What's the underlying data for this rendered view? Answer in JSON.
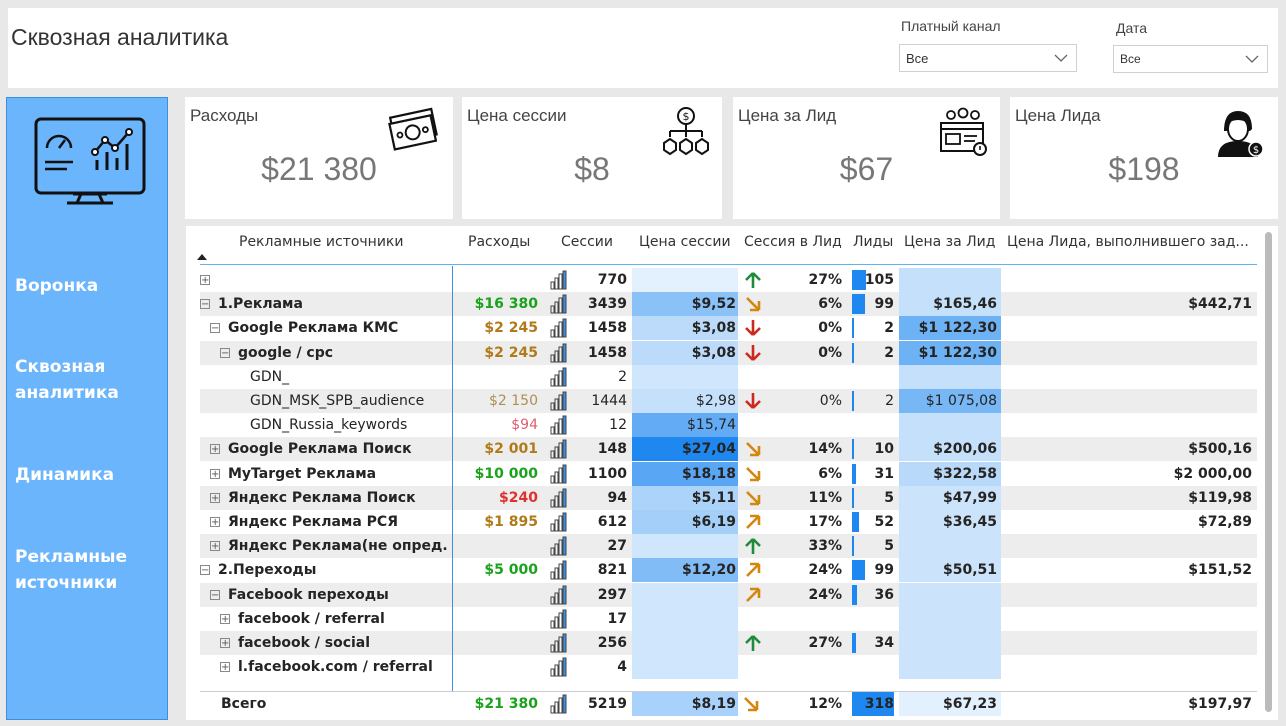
{
  "header": {
    "title": "Сквозная аналитика",
    "slicer1": {
      "label": "Платный канал",
      "value": "Все"
    },
    "slicer2": {
      "label": "Дата",
      "value": "Все"
    }
  },
  "nav": {
    "items": [
      "Воронка",
      "Сквозная аналитика",
      "Динамика",
      "Рекламные источники"
    ]
  },
  "cards": [
    {
      "label": "Расходы",
      "value": "$21 380",
      "icon": "money-icon"
    },
    {
      "label": "Цена сессии",
      "value": "$8",
      "icon": "coins-network-icon"
    },
    {
      "label": "Цена за Лид",
      "value": "$67",
      "icon": "web-form-icon"
    },
    {
      "label": "Цена Лида",
      "value": "$198",
      "icon": "person-dollar-icon"
    }
  ],
  "table": {
    "columns": [
      "Рекламные источники",
      "Расходы",
      "Сессии",
      "Цена сессии",
      "Сессия в Лид",
      "Лиды",
      "Цена за Лид",
      "Цена Лида, выполнившего зад..."
    ],
    "colors": {
      "green": "#1aa31a",
      "orange": "#b07a18",
      "red": "#e03030",
      "pink": "#e05d6e",
      "tan": "#b08f50",
      "arrow_up": "#1e8c3a",
      "arrow_diag": "#d4870f",
      "arrow_down": "#cc2a1e"
    },
    "rows": [
      {
        "level": 0,
        "exp": "+",
        "name": "",
        "bold": true,
        "cost": "",
        "cost_color": "",
        "sessions": "770",
        "cps": "",
        "cps_intensity": 0,
        "arrow": "up",
        "conv": "27%",
        "leads": "105",
        "leads_frac": 0.33,
        "cpl": "",
        "cpl_intensity": 0.15,
        "cpl2": ""
      },
      {
        "level": 0,
        "exp": "−",
        "name": "1.Реклама",
        "bold": true,
        "cost": "$16 380",
        "cost_color": "green",
        "sessions": "3439",
        "cps": "$9,52",
        "cps_intensity": 0.45,
        "arrow": "diag-down",
        "conv": "6%",
        "leads": "99",
        "leads_frac": 0.31,
        "cpl": "$165,46",
        "cpl_intensity": 0.15,
        "cpl2": "$442,71"
      },
      {
        "level": 1,
        "exp": "−",
        "name": "Google Реклама КМС",
        "bold": true,
        "cost": "$2 245",
        "cost_color": "orange",
        "sessions": "1458",
        "cps": "$3,08",
        "cps_intensity": 0.2,
        "arrow": "down",
        "conv": "0%",
        "leads": "2",
        "leads_frac": 0.006,
        "cpl": "$1 122,30",
        "cpl_intensity": 0.6,
        "cpl2": ""
      },
      {
        "level": 2,
        "exp": "−",
        "name": "google / cpc",
        "bold": true,
        "cost": "$2 245",
        "cost_color": "orange",
        "sessions": "1458",
        "cps": "$3,08",
        "cps_intensity": 0.2,
        "arrow": "down",
        "conv": "0%",
        "leads": "2",
        "leads_frac": 0.006,
        "cpl": "$1 122,30",
        "cpl_intensity": 0.6,
        "cpl2": ""
      },
      {
        "level": 3,
        "exp": "",
        "name": "GDN_",
        "bold": false,
        "cost": "",
        "cost_color": "",
        "sessions": "2",
        "cps": "",
        "cps_intensity": 0.1,
        "arrow": "",
        "conv": "",
        "leads": "",
        "leads_frac": 0,
        "cpl": "",
        "cpl_intensity": 0.15,
        "cpl2": ""
      },
      {
        "level": 3,
        "exp": "",
        "name": "GDN_MSK_SPB_audience",
        "bold": false,
        "cost": "$2 150",
        "cost_color": "tan",
        "sessions": "1444",
        "cps": "$2,98",
        "cps_intensity": 0.15,
        "arrow": "down",
        "conv": "0%",
        "leads": "2",
        "leads_frac": 0.006,
        "cpl": "$1 075,08",
        "cpl_intensity": 0.55,
        "cpl2": ""
      },
      {
        "level": 3,
        "exp": "",
        "name": "GDN_Russia_keywords",
        "bold": false,
        "cost": "$94",
        "cost_color": "pink",
        "sessions": "12",
        "cps": "$15,74",
        "cps_intensity": 0.65,
        "arrow": "",
        "conv": "",
        "leads": "",
        "leads_frac": 0,
        "cpl": "",
        "cpl_intensity": 0.15,
        "cpl2": ""
      },
      {
        "level": 1,
        "exp": "+",
        "name": "Google Реклама Поиск",
        "bold": true,
        "cost": "$2 001",
        "cost_color": "orange",
        "sessions": "148",
        "cps": "$27,04",
        "cps_intensity": 1.0,
        "arrow": "diag-down",
        "conv": "14%",
        "leads": "10",
        "leads_frac": 0.03,
        "cpl": "$200,06",
        "cpl_intensity": 0.15,
        "cpl2": "$500,16"
      },
      {
        "level": 1,
        "exp": "+",
        "name": "MyTarget Реклама",
        "bold": true,
        "cost": "$10 000",
        "cost_color": "green",
        "sessions": "1100",
        "cps": "$18,18",
        "cps_intensity": 0.7,
        "arrow": "diag-down",
        "conv": "6%",
        "leads": "31",
        "leads_frac": 0.1,
        "cpl": "$322,58",
        "cpl_intensity": 0.22,
        "cpl2": "$2 000,00"
      },
      {
        "level": 1,
        "exp": "+",
        "name": "Яндекс Реклама Поиск",
        "bold": true,
        "cost": "$240",
        "cost_color": "red",
        "sessions": "94",
        "cps": "$5,11",
        "cps_intensity": 0.28,
        "arrow": "diag-down",
        "conv": "11%",
        "leads": "5",
        "leads_frac": 0.016,
        "cpl": "$47,99",
        "cpl_intensity": 0.12,
        "cpl2": "$119,98"
      },
      {
        "level": 1,
        "exp": "+",
        "name": "Яндекс Реклама РСЯ",
        "bold": true,
        "cost": "$1 895",
        "cost_color": "orange",
        "sessions": "612",
        "cps": "$6,19",
        "cps_intensity": 0.32,
        "arrow": "diag-up",
        "conv": "17%",
        "leads": "52",
        "leads_frac": 0.16,
        "cpl": "$36,45",
        "cpl_intensity": 0.12,
        "cpl2": "$72,89"
      },
      {
        "level": 1,
        "exp": "+",
        "name": "Яндекс Реклама(не опред.)",
        "bold": true,
        "cost": "",
        "cost_color": "",
        "sessions": "27",
        "cps": "",
        "cps_intensity": 0.1,
        "arrow": "up",
        "conv": "33%",
        "leads": "5",
        "leads_frac": 0.016,
        "cpl": "",
        "cpl_intensity": 0.12,
        "cpl2": ""
      },
      {
        "level": 0,
        "exp": "−",
        "name": "2.Переходы",
        "bold": true,
        "cost": "$5 000",
        "cost_color": "green",
        "sessions": "821",
        "cps": "$12,20",
        "cps_intensity": 0.5,
        "arrow": "diag-up",
        "conv": "24%",
        "leads": "99",
        "leads_frac": 0.31,
        "cpl": "$50,51",
        "cpl_intensity": 0.12,
        "cpl2": "$151,52"
      },
      {
        "level": 1,
        "exp": "−",
        "name": "Facebook переходы",
        "bold": true,
        "cost": "",
        "cost_color": "",
        "sessions": "297",
        "cps": "",
        "cps_intensity": 0.1,
        "arrow": "diag-up",
        "conv": "24%",
        "leads": "36",
        "leads_frac": 0.11,
        "cpl": "",
        "cpl_intensity": 0.12,
        "cpl2": ""
      },
      {
        "level": 2,
        "exp": "+",
        "name": "facebook / referral",
        "bold": true,
        "cost": "",
        "cost_color": "",
        "sessions": "17",
        "cps": "",
        "cps_intensity": 0.1,
        "arrow": "",
        "conv": "",
        "leads": "",
        "leads_frac": 0,
        "cpl": "",
        "cpl_intensity": 0.12,
        "cpl2": ""
      },
      {
        "level": 2,
        "exp": "+",
        "name": "facebook / social",
        "bold": true,
        "cost": "",
        "cost_color": "",
        "sessions": "256",
        "cps": "",
        "cps_intensity": 0.1,
        "arrow": "up",
        "conv": "27%",
        "leads": "34",
        "leads_frac": 0.1,
        "cpl": "",
        "cpl_intensity": 0.12,
        "cpl2": ""
      },
      {
        "level": 2,
        "exp": "+",
        "name": "l.facebook.com / referral",
        "bold": true,
        "cost": "",
        "cost_color": "",
        "sessions": "4",
        "cps": "",
        "cps_intensity": 0.1,
        "arrow": "",
        "conv": "",
        "leads": "",
        "leads_frac": 0,
        "cpl": "",
        "cpl_intensity": 0.12,
        "cpl2": ""
      }
    ],
    "total": {
      "name": "Всего",
      "cost": "$21 380",
      "sessions": "5219",
      "cps": "$8,19",
      "conv": "12%",
      "leads": "318",
      "leads_frac": 1.0,
      "cpl": "$67,23",
      "cpl2": "$197,97"
    }
  }
}
